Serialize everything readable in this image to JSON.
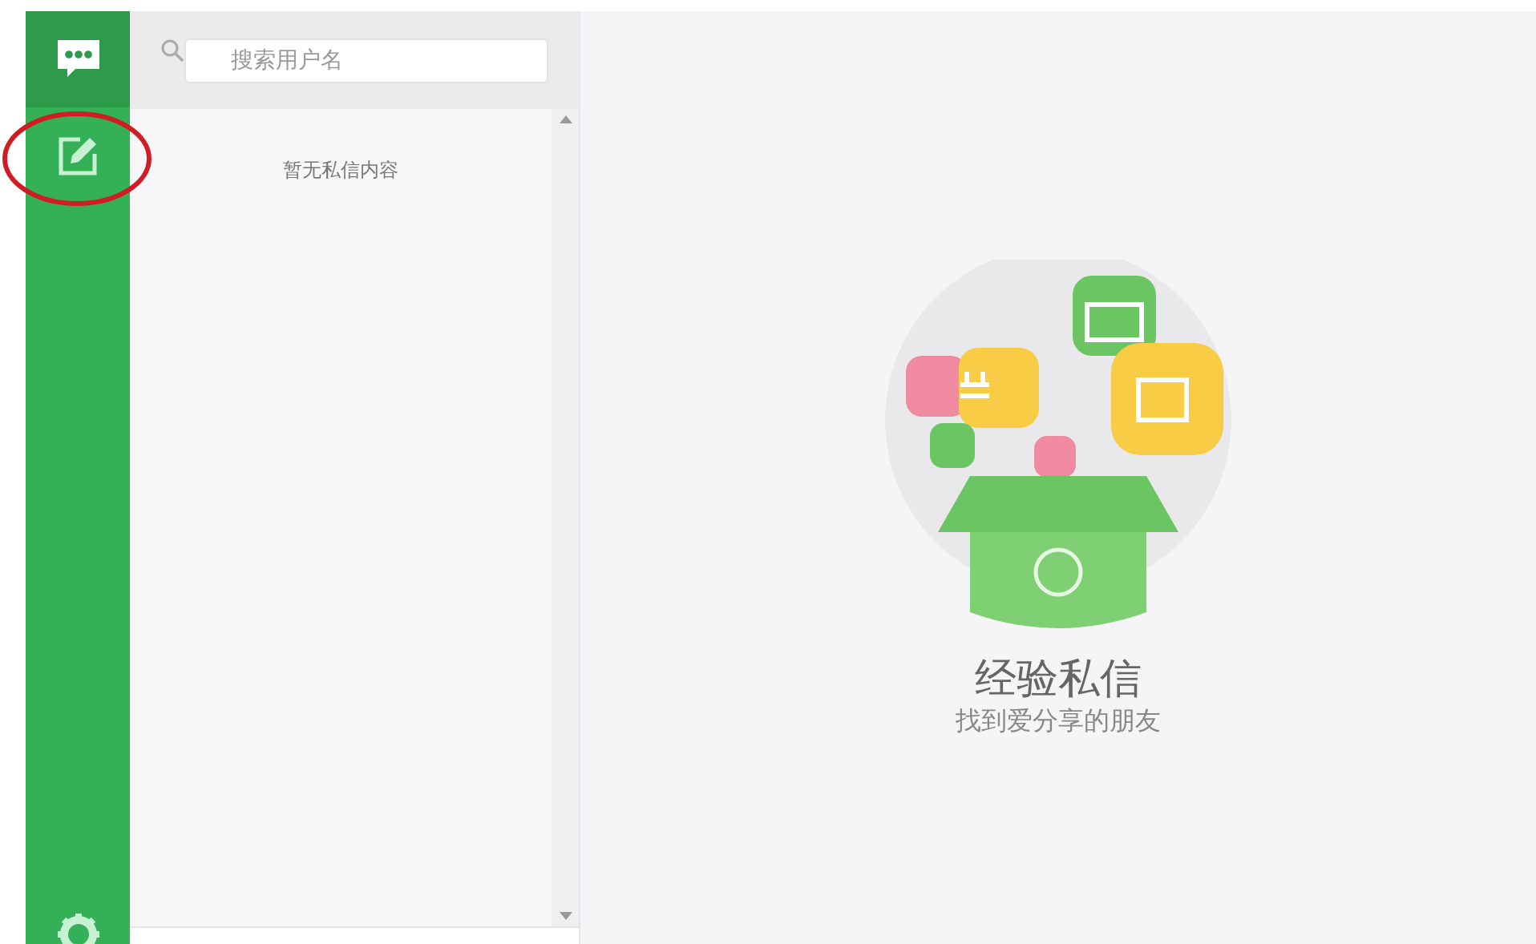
{
  "sidebar": {
    "items": [
      {
        "kind": "messages",
        "selected": true
      },
      {
        "kind": "compose",
        "selected": false
      }
    ],
    "footer": {
      "kind": "settings"
    }
  },
  "conversation_list": {
    "search": {
      "placeholder": "搜索用户名"
    },
    "empty_text": "暂无私信内容"
  },
  "main": {
    "title": "经验私信",
    "subtitle": "找到爱分享的朋友"
  }
}
